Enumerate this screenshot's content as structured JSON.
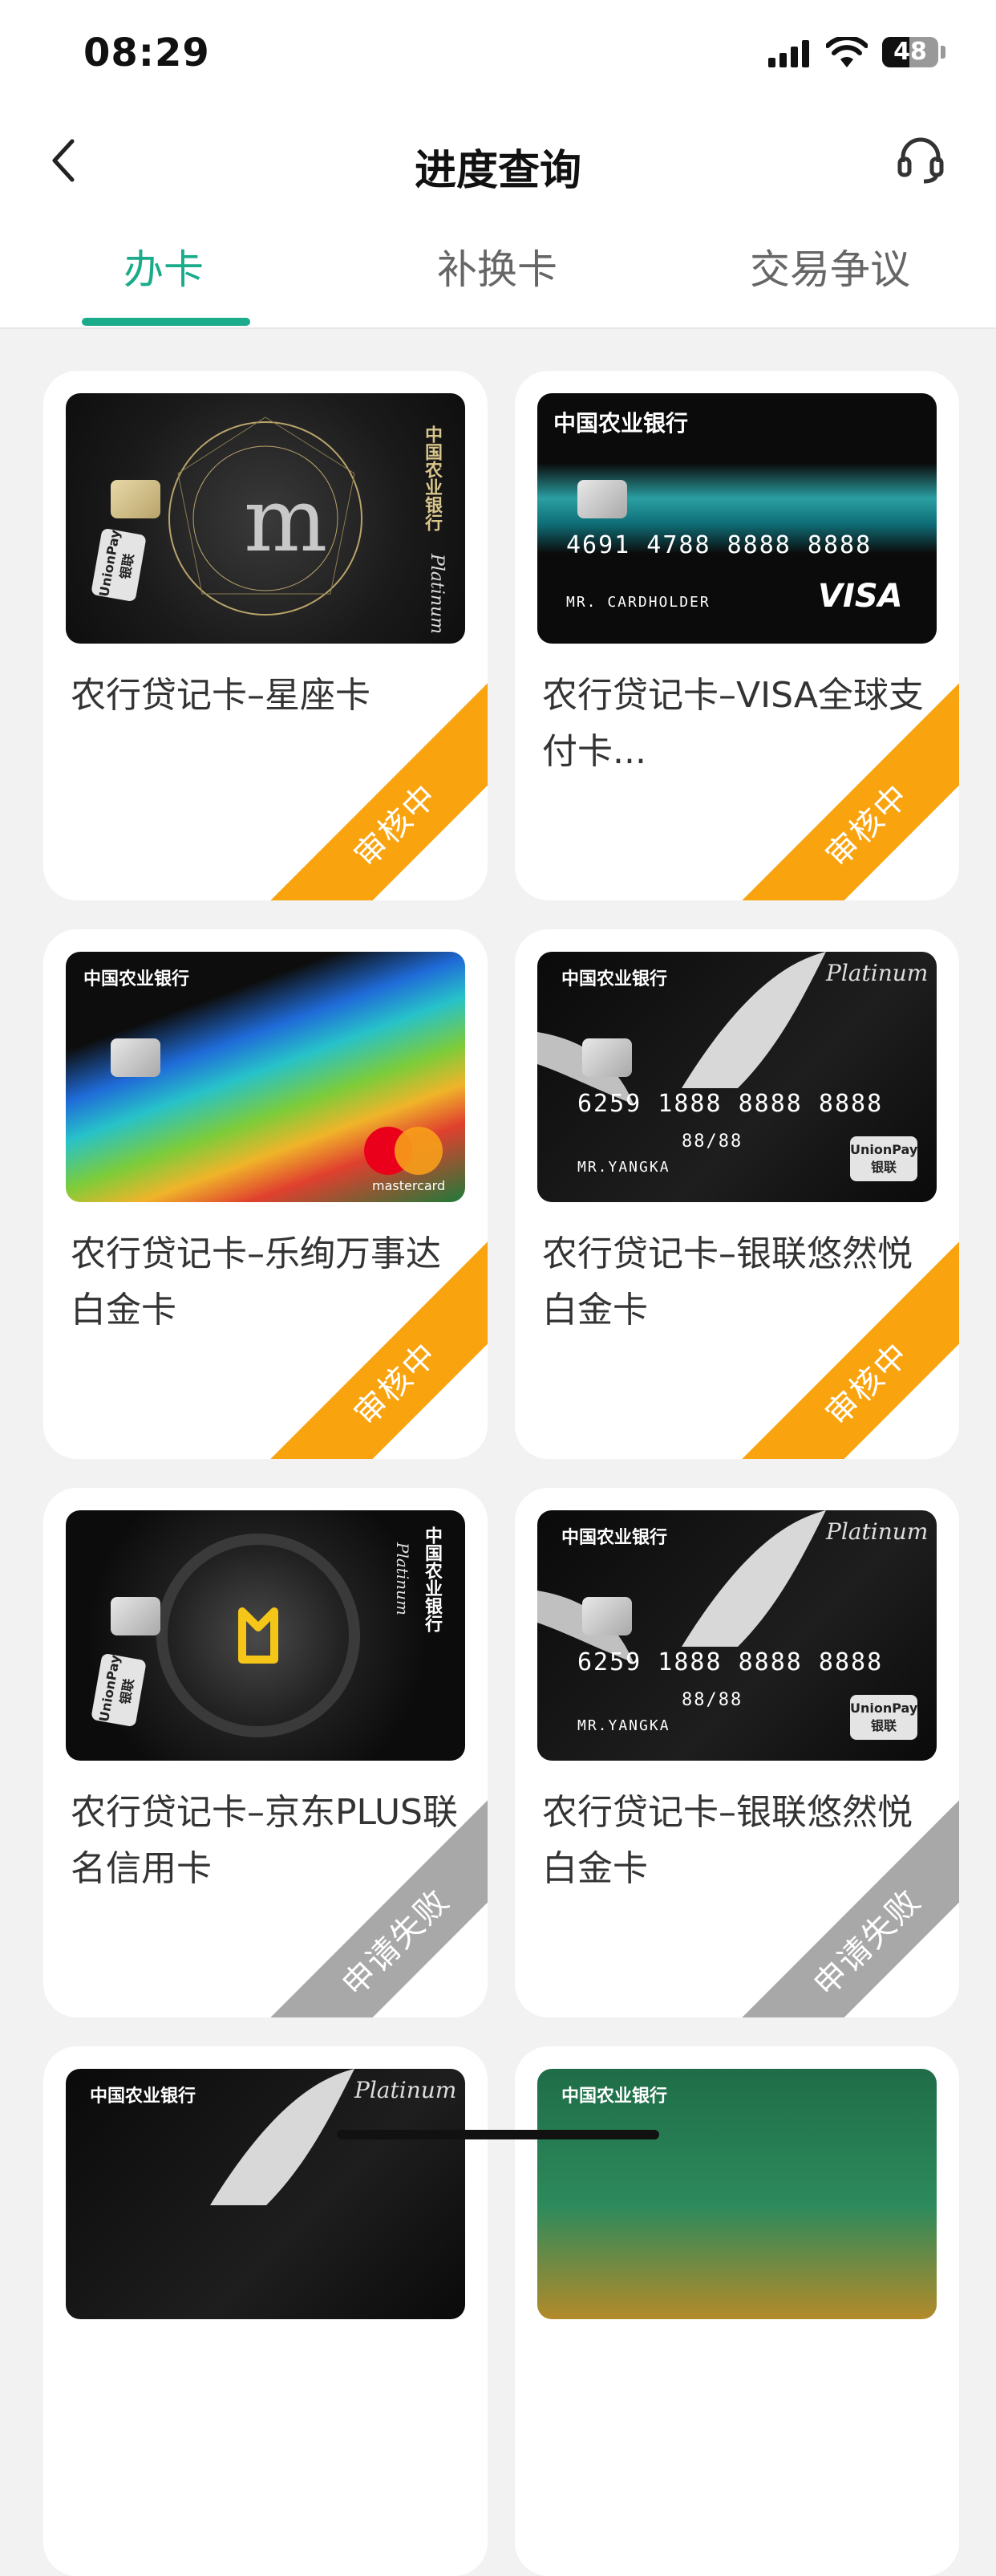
{
  "status_bar": {
    "time": "08:29",
    "battery": "48"
  },
  "header": {
    "title": "进度查询",
    "back_icon": "chevron-left-icon",
    "support_icon": "headset-icon"
  },
  "tabs": [
    {
      "label": "办卡",
      "active": true
    },
    {
      "label": "补换卡",
      "active": false
    },
    {
      "label": "交易争议",
      "active": false
    }
  ],
  "accent_color": "#1aab8a",
  "status_colors": {
    "审核中": "#f9a30f",
    "申请失败": "#a8a8a8"
  },
  "cards": [
    {
      "name": "农行贷记卡–星座卡",
      "status": "审核中",
      "art": {
        "bank": "中国农业银行",
        "network": "UnionPay 银联",
        "tier": "Platinum"
      }
    },
    {
      "name": "农行贷记卡–VISA全球支付卡...",
      "status": "审核中",
      "art": {
        "bank": "中国农业银行",
        "number": "4691 4788 8888 8888",
        "holder": "MR. CARDHOLDER",
        "network": "VISA"
      }
    },
    {
      "name": "农行贷记卡–乐绚万事达白金卡",
      "status": "审核中",
      "art": {
        "bank": "中国农业银行",
        "network": "mastercard"
      }
    },
    {
      "name": "农行贷记卡–银联悠然悦白金卡",
      "status": "审核中",
      "art": {
        "bank": "中国农业银行",
        "tier": "Platinum",
        "number": "6259 1888 8888 8888",
        "expiry": "88/88",
        "holder": "MR.YANGKA",
        "network": "UnionPay 银联"
      }
    },
    {
      "name": "农行贷记卡–京东PLUS联名信用卡",
      "status": "申请失败",
      "art": {
        "bank": "中国农业银行",
        "tier": "Platinum",
        "network": "UnionPay 银联"
      }
    },
    {
      "name": "农行贷记卡–银联悠然悦白金卡",
      "status": "申请失败",
      "art": {
        "bank": "中国农业银行",
        "tier": "Platinum",
        "number": "6259 1888 8888 8888",
        "expiry": "88/88",
        "holder": "MR.YANGKA",
        "network": "UnionPay 银联"
      }
    },
    {
      "name": "",
      "status": "",
      "art": {
        "bank": "中国农业银行",
        "tier": "Platinum"
      }
    },
    {
      "name": "",
      "status": "",
      "art": {
        "bank": "中国农业银行"
      }
    }
  ]
}
